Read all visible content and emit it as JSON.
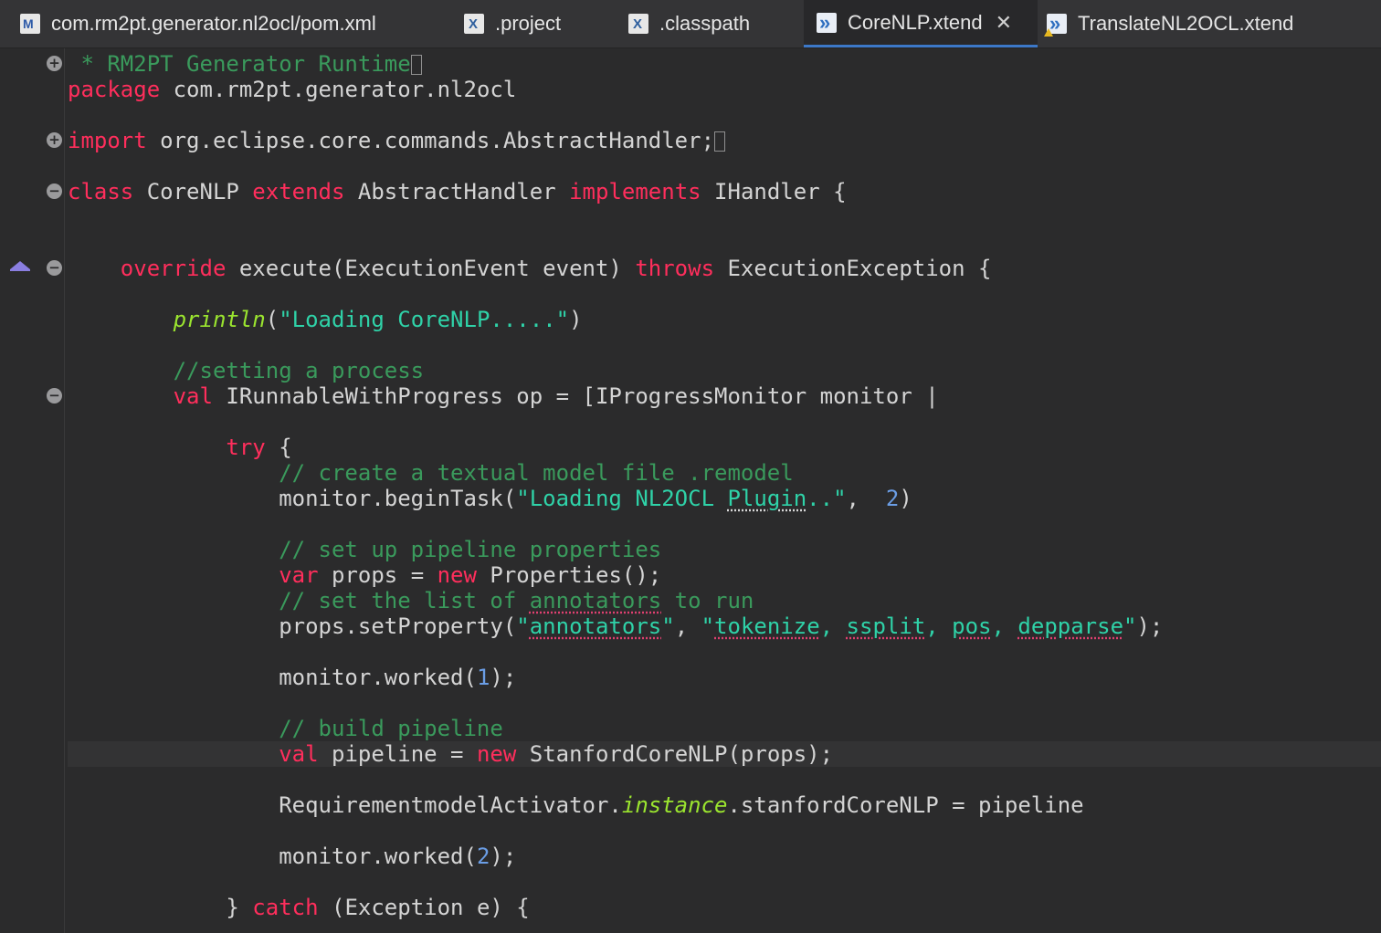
{
  "tabs": [
    {
      "label": "com.rm2pt.generator.nl2ocl/pom.xml",
      "icon": "maven-file-icon"
    },
    {
      "label": ".project",
      "icon": "xml-file-icon"
    },
    {
      "label": ".classpath",
      "icon": "xml-file-icon"
    },
    {
      "label": "CoreNLP.xtend",
      "icon": "xtend-file-icon",
      "active": true
    },
    {
      "label": "TranslateNL2OCL.xtend",
      "icon": "xtend-file-warning-icon"
    }
  ],
  "code": {
    "l1": {
      "a": " * RM2PT Generator Runtime"
    },
    "l2": {
      "a": "package",
      "b": " com.rm2pt.generator.nl2ocl"
    },
    "l3": {
      "a": "import",
      "b": " org.eclipse.core.commands.AbstractHandler;"
    },
    "l4": {
      "a": "class",
      "b": " CoreNLP ",
      "c": "extends",
      "d": " AbstractHandler ",
      "e": "implements",
      "f": " IHandler {"
    },
    "l5": {
      "i": "    ",
      "a": "override",
      "b": " execute(ExecutionEvent event) ",
      "c": "throws",
      "d": " ExecutionException {"
    },
    "l6": {
      "i": "        ",
      "a": "println",
      "b": "(",
      "c": "\"Loading CoreNLP.....\"",
      "d": ")"
    },
    "l7": {
      "i": "        ",
      "a": "//setting a process"
    },
    "l8": {
      "i": "        ",
      "a": "val",
      "b": " IRunnableWithProgress op = [IProgressMonitor monitor |"
    },
    "l9": {
      "i": "            ",
      "a": "try",
      "b": " {"
    },
    "l10": {
      "i": "                ",
      "a": "// create a textual model file .remodel"
    },
    "l11": {
      "i": "                ",
      "a": "monitor.beginTask(",
      "b": "\"Loading NL2OCL ",
      "c": "Plugin",
      "d": "..\"",
      "e": ",  ",
      "f": "2",
      "g": ")"
    },
    "l12": {
      "i": "                ",
      "a": "// set up pipeline properties"
    },
    "l13": {
      "i": "                ",
      "a": "var",
      "b": " props = ",
      "c": "new",
      "d": " Properties();"
    },
    "l14": {
      "i": "                ",
      "a": "// set the list of ",
      "b": "annotators",
      "c": " to run"
    },
    "l15": {
      "i": "                ",
      "a": "props.setProperty(",
      "b": "\"",
      "c": "annotators",
      "d": "\"",
      "e": ", ",
      "f": "\"",
      "g": "tokenize",
      "h": ", ",
      "j": "ssplit",
      "k": ", ",
      "m": "pos",
      "n": ", ",
      "o": "depparse",
      "p": "\"",
      "q": ");"
    },
    "l16": {
      "i": "                ",
      "a": "monitor.worked(",
      "b": "1",
      "c": ");"
    },
    "l17": {
      "i": "                ",
      "a": "// build pipeline"
    },
    "l18": {
      "i": "                ",
      "a": "val",
      "b": " pipeline = ",
      "c": "new",
      "d": " StanfordCoreNLP(props);"
    },
    "l19": {
      "i": "                ",
      "a": "RequirementmodelActivator.",
      "b": "instance",
      "c": ".stanfordCoreNLP = pipeline"
    },
    "l20": {
      "i": "                ",
      "a": "monitor.worked(",
      "b": "2",
      "c": ");"
    },
    "l21": {
      "i": "            ",
      "a": "} ",
      "b": "catch",
      "c": " (Exception e) {"
    }
  }
}
